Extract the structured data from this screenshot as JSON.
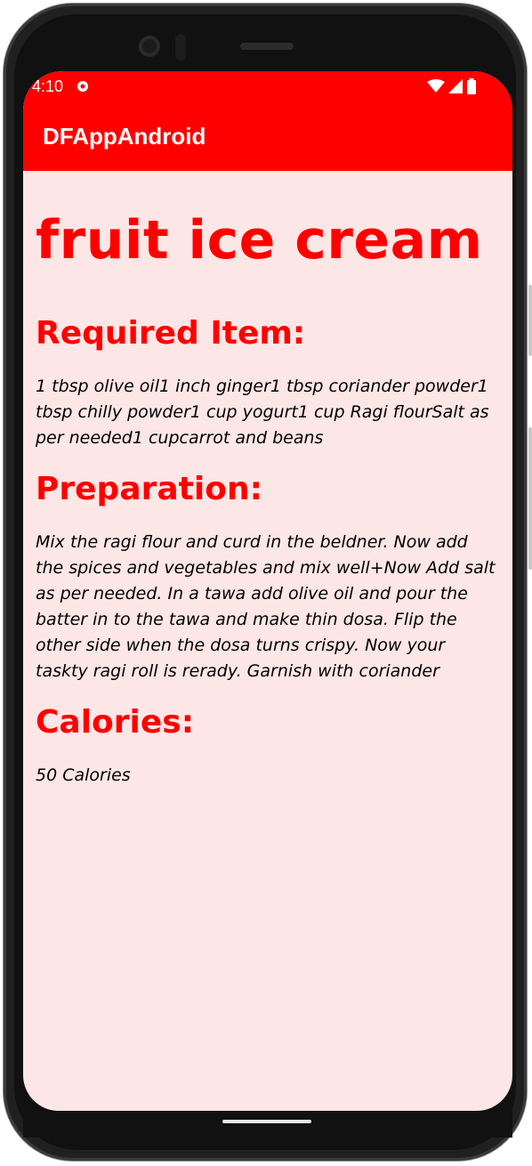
{
  "status_bar": {
    "time": "4:10",
    "notification_icon": "record-icon",
    "icons": [
      "wifi-icon",
      "signal-icon",
      "battery-icon"
    ],
    "color": "#ff0000"
  },
  "app_bar": {
    "title": "DFAppAndroid",
    "color": "#ff0000"
  },
  "recipe": {
    "title": "fruit ice cream",
    "required_heading": "Required Item:",
    "required_items": "1 tbsp olive oil1 inch ginger1 tbsp coriander powder1 tbsp chilly powder1 cup yogurt1 cup Ragi flourSalt as per needed1 cupcarrot and beans",
    "preparation_heading": "Preparation:",
    "preparation": "Mix the ragi flour and curd in the beldner. Now add the spices and vegetables and mix well+Now Add salt as per needed. In a tawa add olive oil and pour the batter in to the tawa and make thin  dosa. Flip the other side when the dosa turns crispy. Now your taskty ragi roll is rerady. Garnish with coriander",
    "calories_heading": "Calories:",
    "calories": "50 Calories"
  },
  "colors": {
    "accent": "#ff0000",
    "background": "#fde6e6",
    "body_text": "#000000"
  }
}
